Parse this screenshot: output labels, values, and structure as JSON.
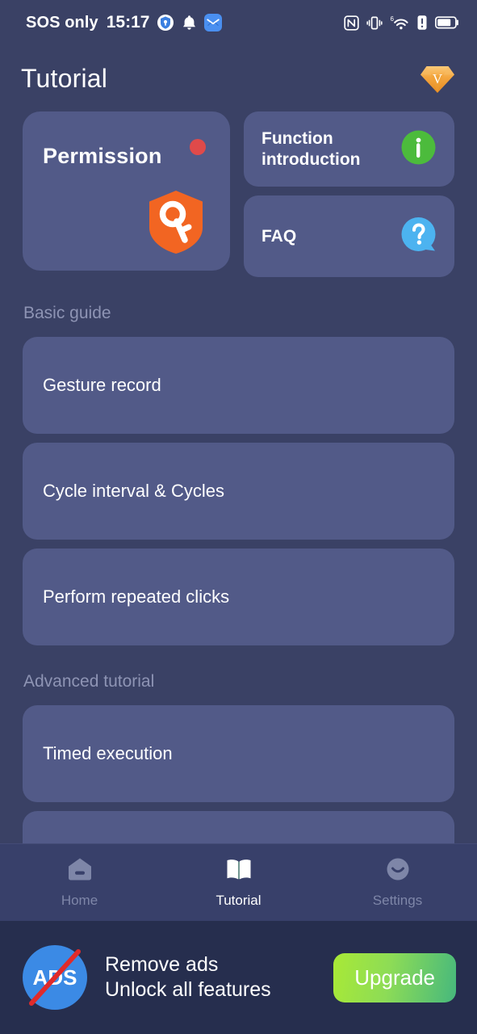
{
  "status_bar": {
    "carrier": "SOS only",
    "time": "15:17",
    "left_icons": [
      "shield-badge-icon",
      "bell-icon",
      "mail-icon"
    ],
    "right_icons": [
      "nfc-icon",
      "vibrate-icon",
      "wifi-6-icon",
      "alert-icon",
      "battery-icon"
    ],
    "wifi_generation": "6"
  },
  "header": {
    "title": "Tutorial",
    "vip_badge_letter": "V",
    "vip_badge_icon": "diamond-vip-icon"
  },
  "top_cards": {
    "permission": {
      "label": "Permission",
      "icon": "key-shield-icon",
      "has_alert_dot": true
    },
    "function_introduction": {
      "label": "Function introduction",
      "icon": "info-circle-icon"
    },
    "faq": {
      "label": "FAQ",
      "icon": "question-bubble-icon"
    }
  },
  "sections": [
    {
      "heading": "Basic guide",
      "items": [
        {
          "label": "Gesture record"
        },
        {
          "label": "Cycle interval & Cycles"
        },
        {
          "label": "Perform repeated clicks"
        }
      ]
    },
    {
      "heading": "Advanced tutorial",
      "items": [
        {
          "label": "Timed execution"
        },
        {
          "label": ""
        }
      ]
    }
  ],
  "bottom_nav": {
    "items": [
      {
        "label": "Home",
        "icon": "home-icon",
        "active": false
      },
      {
        "label": "Tutorial",
        "icon": "book-icon",
        "active": true
      },
      {
        "label": "Settings",
        "icon": "smiley-icon",
        "active": false
      }
    ]
  },
  "ad_banner": {
    "icon": "no-ads-icon",
    "icon_text": "ADS",
    "line1": "Remove ads",
    "line2": "Unlock all features",
    "button_label": "Upgrade"
  },
  "colors": {
    "background": "#3a4165",
    "card": "#525a88",
    "navbar": "#38406a",
    "banner": "#262e4e",
    "accent_orange": "#f26522",
    "accent_green": "#46b24b",
    "accent_blue": "#4cb3f0",
    "alert_red": "#e04a4a",
    "vip_gold": "#f2a03d",
    "muted_text": "#8e94b4"
  }
}
